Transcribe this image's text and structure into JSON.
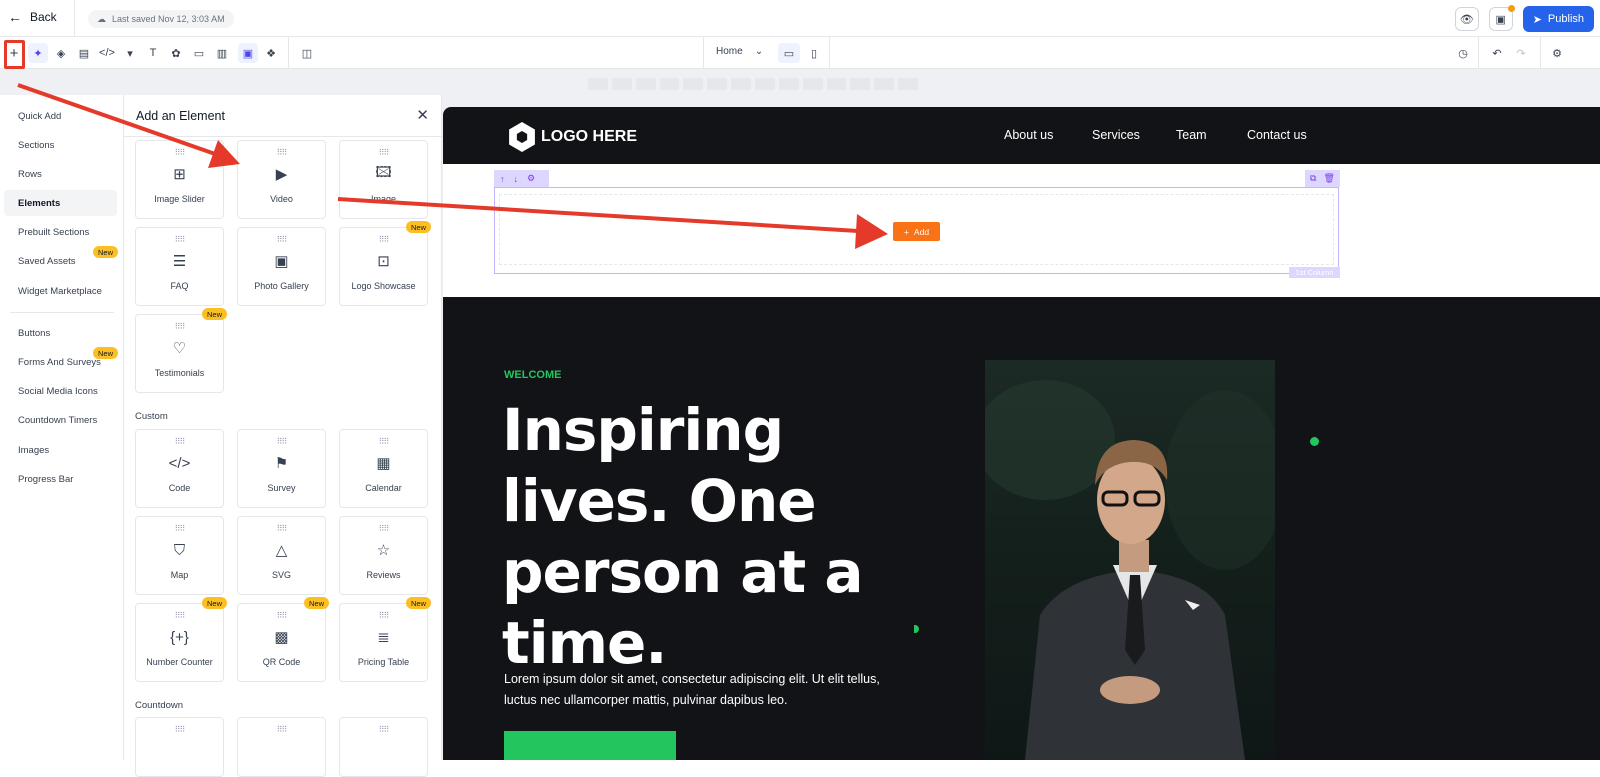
{
  "topbar": {
    "back_label": "Back",
    "last_saved": "Last saved Nov 12, 3:03 AM",
    "publish_label": "Publish"
  },
  "toolbar": {
    "page_selector": "Home"
  },
  "leftnav": {
    "items": [
      {
        "label": "Quick Add"
      },
      {
        "label": "Sections"
      },
      {
        "label": "Rows"
      },
      {
        "label": "Elements"
      },
      {
        "label": "Prebuilt Sections"
      },
      {
        "label": "Saved Assets",
        "badge": "New"
      },
      {
        "label": "Widget Marketplace"
      },
      {
        "label": "Buttons"
      },
      {
        "label": "Forms And Surveys",
        "badge": "New"
      },
      {
        "label": "Social Media Icons"
      },
      {
        "label": "Countdown Timers"
      },
      {
        "label": "Images"
      },
      {
        "label": "Progress Bar"
      }
    ],
    "active": "Elements"
  },
  "panel": {
    "title": "Add an Element",
    "cards": [
      {
        "label": "Image Slider",
        "icon": "image-slider-icon"
      },
      {
        "label": "Video",
        "icon": "video-icon"
      },
      {
        "label": "Image",
        "icon": "image-icon"
      },
      {
        "label": "FAQ",
        "icon": "faq-icon"
      },
      {
        "label": "Photo Gallery",
        "icon": "photo-gallery-icon"
      },
      {
        "label": "Logo Showcase",
        "icon": "logo-showcase-icon",
        "badge": "New"
      },
      {
        "label": "Testimonials",
        "icon": "testimonials-icon",
        "badge": "New"
      }
    ],
    "custom_heading": "Custom",
    "custom_cards": [
      {
        "label": "Code",
        "icon": "code-icon"
      },
      {
        "label": "Survey",
        "icon": "survey-icon"
      },
      {
        "label": "Calendar",
        "icon": "calendar-icon"
      },
      {
        "label": "Map",
        "icon": "map-icon"
      },
      {
        "label": "SVG",
        "icon": "svg-icon"
      },
      {
        "label": "Reviews",
        "icon": "reviews-icon"
      },
      {
        "label": "Number Counter",
        "icon": "number-counter-icon",
        "badge": "New"
      },
      {
        "label": "QR Code",
        "icon": "qr-code-icon",
        "badge": "New"
      },
      {
        "label": "Pricing Table",
        "icon": "pricing-table-icon",
        "badge": "New"
      }
    ],
    "countdown_heading": "Countdown"
  },
  "site": {
    "logo_text": "LOGO HERE",
    "nav": [
      "About us",
      "Services",
      "Team",
      "Contact us"
    ],
    "add_label": "Add",
    "column_badge": "1st Column",
    "welcome": "WELCOME",
    "headline": "Inspiring lives. One person at a time.",
    "body": "Lorem ipsum dolor sit amet, consectetur adipiscing elit. Ut elit tellus, luctus nec ullamcorper mattis, pulvinar dapibus leo."
  },
  "colors": {
    "accent": "#2563eb",
    "annotation": "#e53a2a",
    "add_button": "#f97316",
    "hero_green": "#22c55e",
    "badge_new": "#fbbf24"
  }
}
